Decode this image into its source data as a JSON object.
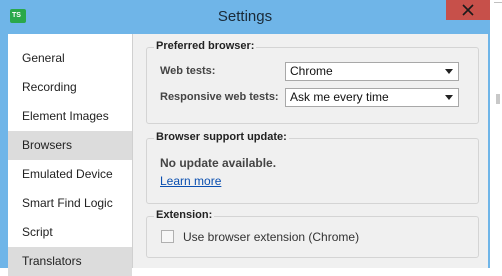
{
  "window": {
    "title": "Settings",
    "app_icon_text": "TS",
    "colors": {
      "titlebar": "#6fb5e8",
      "close_button": "#c7504a",
      "link": "#0a4fb0",
      "selected_nav": "#dcdcdc"
    }
  },
  "sidebar": {
    "items": [
      {
        "label": "General"
      },
      {
        "label": "Recording"
      },
      {
        "label": "Element Images"
      },
      {
        "label": "Browsers",
        "selected": true
      },
      {
        "label": "Emulated Device"
      },
      {
        "label": "Smart Find Logic"
      },
      {
        "label": "Script"
      },
      {
        "label": "Translators",
        "selected": true
      }
    ]
  },
  "preferred_browser": {
    "heading": "Preferred browser:",
    "web_tests_label": "Web tests:",
    "web_tests_value": "Chrome",
    "responsive_label": "Responsive web tests:",
    "responsive_value": "Ask me every time"
  },
  "browser_update": {
    "heading": "Browser support update:",
    "status": "No update available.",
    "learn_more": "Learn more"
  },
  "extension": {
    "heading": "Extension:",
    "checkbox_label": "Use browser extension (Chrome)",
    "checked": false
  }
}
